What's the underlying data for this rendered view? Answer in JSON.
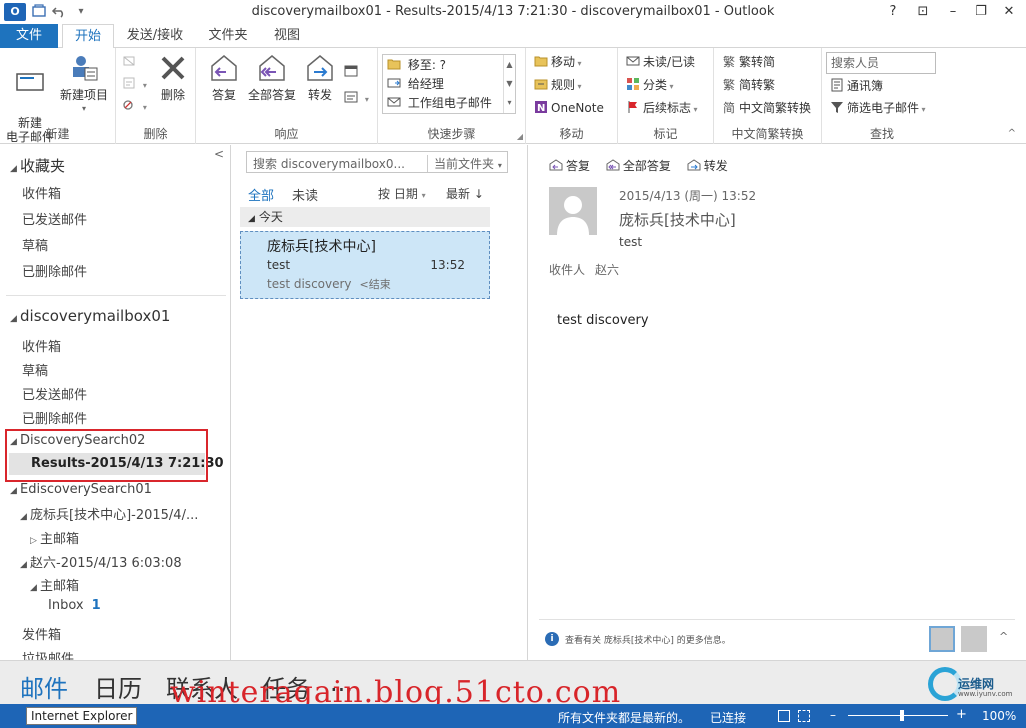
{
  "window": {
    "app_logo": "O",
    "title": "discoverymailbox01 - Results-2015/4/13 7:21:30 - discoverymailbox01 - Outlook",
    "help": "?",
    "restore_ribbon": "⊡",
    "minimize": "–",
    "maximize": "❐",
    "close": "✕"
  },
  "tabs": {
    "file": "文件",
    "items": [
      "开始",
      "发送/接收",
      "文件夹",
      "视图"
    ],
    "active": "开始"
  },
  "ribbon": {
    "new": {
      "new_email": "新建\n电子邮件",
      "new_items": "新建项目",
      "label": "新建"
    },
    "delete": {
      "delete": "删除",
      "label": "删除"
    },
    "respond": {
      "reply": "答复",
      "reply_all": "全部答复",
      "forward": "转发",
      "label": "响应"
    },
    "quick_steps": {
      "items": [
        "移至: ?",
        "给经理",
        "工作组电子邮件"
      ],
      "label": "快速步骤"
    },
    "move": {
      "move": "移动",
      "rules": "规则",
      "onenote": "OneNote",
      "label": "移动"
    },
    "tags": {
      "unread_read": "未读/已读",
      "categorize": "分类",
      "follow_up": "后续标志",
      "label": "标记"
    },
    "chinese_conv": {
      "to_simplified": "繁转简",
      "to_traditional": "简转繁",
      "convert": "中文简繁转换",
      "label": "中文简繁转换"
    },
    "find": {
      "search_people": "搜索人员",
      "address_book": "通讯簿",
      "filter_email": "筛选电子邮件",
      "label": "查找"
    }
  },
  "nav": {
    "favorites": "收藏夹",
    "fav_items": [
      "收件箱",
      "已发送邮件",
      "草稿",
      "已删除邮件"
    ],
    "mailbox": "discoverymailbox01",
    "mailbox_items": [
      "收件箱",
      "草稿",
      "已发送邮件",
      "已删除邮件"
    ],
    "search02": "DiscoverySearch02",
    "results": "Results-2015/4/13 7:21:30",
    "esearch01": "EdiscoverySearch01",
    "pang": "庞标兵[技术中心]-2015/4/...",
    "main_mailbox_1": "主邮箱",
    "zhao": "赵六-2015/4/13 6:03:08",
    "main_mailbox_2": "主邮箱",
    "inbox": "Inbox",
    "inbox_count": "1",
    "outbox": "发件箱",
    "junk": "垃圾邮件"
  },
  "msglist": {
    "search_placeholder": "搜索 discoverymailbox0...",
    "scope": "当前文件夹",
    "filter_all": "全部",
    "filter_unread": "未读",
    "sort_by": "按 日期",
    "order": "最新 ↓",
    "group_today": "今天",
    "message": {
      "sender": "庞标兵[技术中心]",
      "subject": "test",
      "time": "13:52",
      "preview": "test discovery",
      "end_marker": "<结束"
    }
  },
  "reading": {
    "reply": "答复",
    "reply_all": "全部答复",
    "forward": "转发",
    "date": "2015/4/13 (周一) 13:52",
    "sender": "庞标兵[技术中心]",
    "subject": "test",
    "to_label": "收件人",
    "to_name": "赵六",
    "body": "test discovery",
    "people_info": "查看有关 庞标兵[技术中心] 的更多信息。"
  },
  "bottomnav": {
    "items": [
      "邮件",
      "日历",
      "联系人",
      "任务",
      "..."
    ],
    "watermark": "winteragain.blog.51cto.com",
    "logo_text": "运维网",
    "logo_sub": "www.iyunv.com"
  },
  "statusbar": {
    "tooltip": "Internet Explorer",
    "folders_uptodate": "所有文件夹都是最新的。",
    "connected": "已连接",
    "zoom": "100%"
  },
  "colors": {
    "accent": "#1e73be",
    "status_bar": "#1e65b6",
    "selected_message": "#cde6f7",
    "highlight_box": "#d9262c",
    "watermark": "#d8252a"
  }
}
